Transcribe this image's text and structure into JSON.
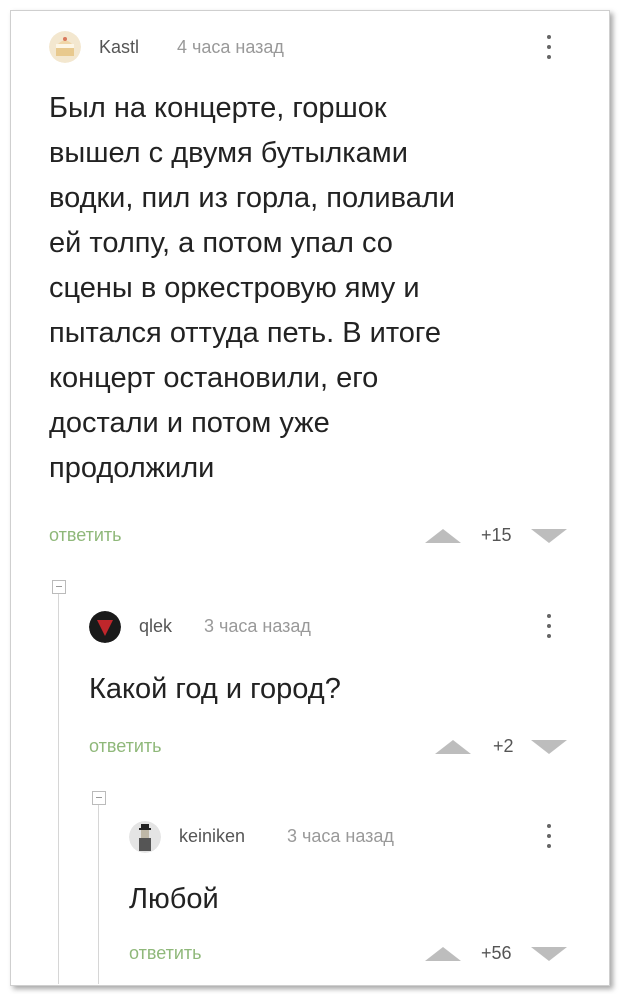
{
  "comments": [
    {
      "author": "Kastl",
      "time": "4 часа назад",
      "text_lines": [
        "Был на концерте, горшок",
        "вышел с двумя бутылками",
        "водки, пил из горла, поливали",
        "ей толпу, а потом упал со",
        "сцены в оркестровую яму и",
        "пытался оттуда петь. В итоге",
        "концерт остановили, его",
        "достали и потом уже",
        "продолжили"
      ],
      "reply_label": "ответить",
      "score": "+15",
      "avatar_icon": "cake-avatar-icon"
    },
    {
      "author": "qlek",
      "time": "3 часа назад",
      "text": "Какой год и город?",
      "reply_label": "ответить",
      "score": "+2",
      "avatar_icon": "red-dark-avatar-icon"
    },
    {
      "author": "keiniken",
      "time": "3 часа назад",
      "text": "Любой",
      "reply_label": "ответить",
      "score": "+56",
      "avatar_icon": "figure-avatar-icon"
    }
  ],
  "colors": {
    "reply": "#8fb87a",
    "vote_arrow": "#bdbdbd",
    "thread_line": "#d6d6d6"
  }
}
